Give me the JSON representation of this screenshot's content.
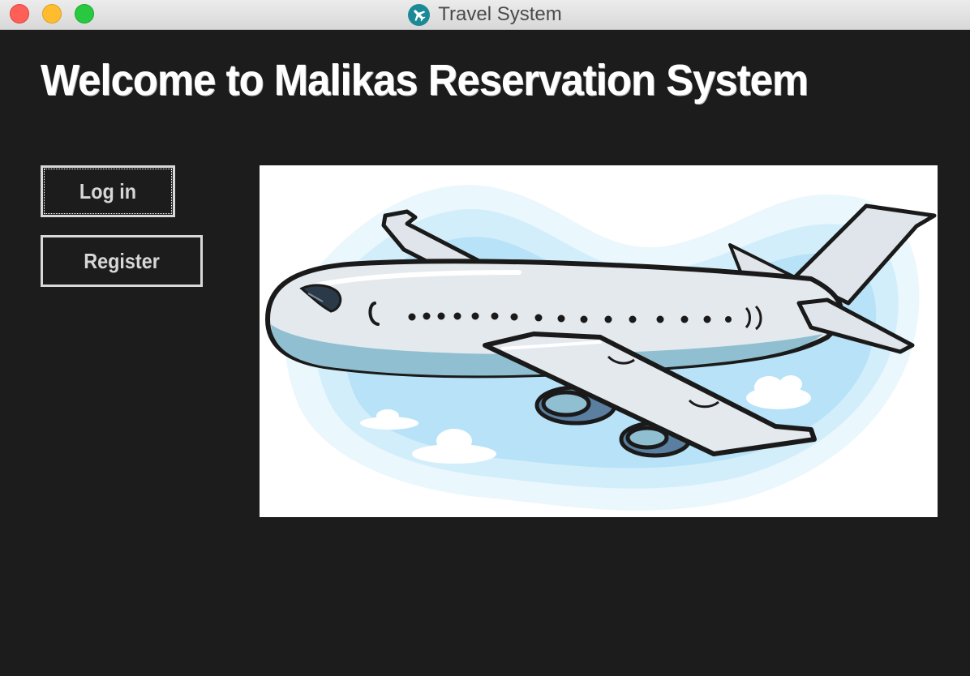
{
  "window": {
    "title": "Travel System",
    "app_icon": "airplane-icon"
  },
  "main": {
    "heading": "Welcome to Malikas Reservation System",
    "buttons": {
      "login_label": "Log in",
      "register_label": "Register"
    },
    "illustration": "airplane-illustration"
  },
  "colors": {
    "background": "#1c1c1c",
    "heading": "#ffffff",
    "button_text": "#d7d7d7",
    "button_border": "#d8d8d8",
    "app_icon": "#1c8a96",
    "sky": "#b8e2f7"
  }
}
